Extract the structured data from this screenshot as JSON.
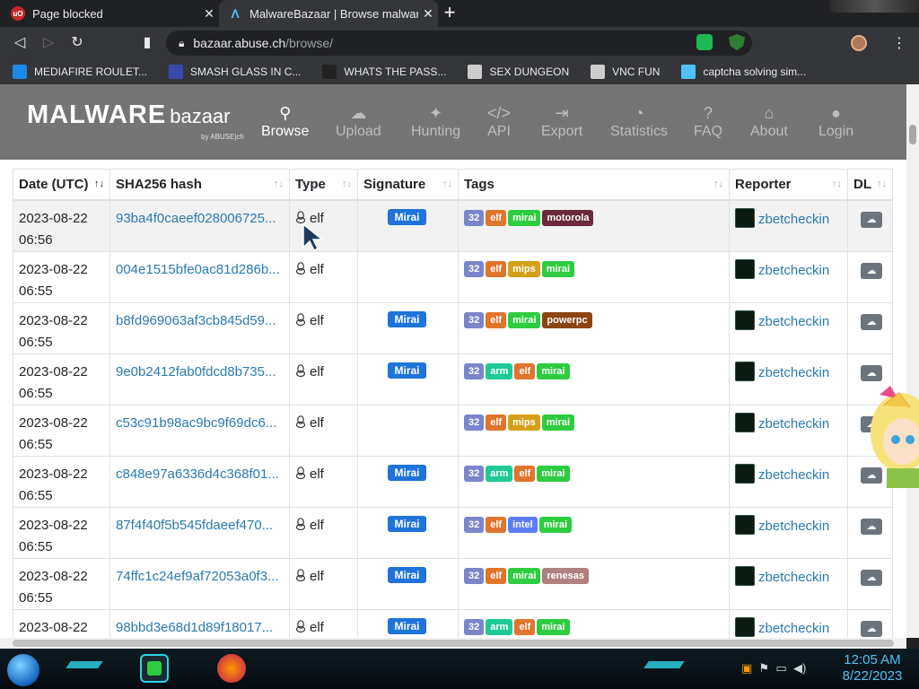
{
  "browser": {
    "tabs": [
      {
        "title": "Page blocked",
        "favicon": "ublock-icon",
        "active": false
      },
      {
        "title": "MalwareBazaar | Browse malware s",
        "favicon": "malwarebazaar-icon",
        "active": true
      }
    ],
    "url_domain": "bazaar.abuse.ch",
    "url_path": "/browse/",
    "bookmarks": [
      {
        "label": "MEDIAFIRE ROULET...",
        "icon": "mediafire-icon",
        "color": "#1e88e5"
      },
      {
        "label": "SMASH GLASS IN C...",
        "icon": "sigma-icon",
        "color": "#3949ab"
      },
      {
        "label": "WHATS THE PASS...",
        "icon": "dark-square-icon",
        "color": "#222222"
      },
      {
        "label": "SEX DUNGEON",
        "icon": "gear-icon",
        "color": "#cccccc"
      },
      {
        "label": "VNC FUN",
        "icon": "gear-icon",
        "color": "#cccccc"
      },
      {
        "label": "captcha solving sim...",
        "icon": "malwarebazaar-icon",
        "color": "#4fc3f7"
      }
    ]
  },
  "site": {
    "brand_main": "MALWARE",
    "brand_sub": "bazaar",
    "brand_by": "by ABUSE|ch",
    "nav": [
      {
        "label": "Browse",
        "icon": "search-icon",
        "active": true
      },
      {
        "label": "Upload",
        "icon": "cloud-upload-icon",
        "active": false
      },
      {
        "label": "Hunting",
        "icon": "hunting-icon",
        "active": false
      },
      {
        "label": "API",
        "icon": "code-icon",
        "active": false
      },
      {
        "label": "Export",
        "icon": "export-icon",
        "active": false
      },
      {
        "label": "Statistics",
        "icon": "pie-chart-icon",
        "active": false
      },
      {
        "label": "FAQ",
        "icon": "question-icon",
        "active": false
      },
      {
        "label": "About",
        "icon": "building-icon",
        "active": false
      },
      {
        "label": "Login",
        "icon": "user-icon",
        "active": false
      }
    ]
  },
  "table": {
    "headers": [
      "Date (UTC)",
      "SHA256 hash",
      "Type",
      "Signature",
      "Tags",
      "Reporter",
      "DL"
    ],
    "rows": [
      {
        "date": "2023-08-22",
        "time": "06:56",
        "hash": "93ba4f0caeef028006725...",
        "type": "elf",
        "signature": "Mirai",
        "tags": [
          "32",
          "elf",
          "mirai",
          "motorola"
        ],
        "reporter": "zbetcheckin"
      },
      {
        "date": "2023-08-22",
        "time": "06:55",
        "hash": "004e1515bfe0ac81d286b...",
        "type": "elf",
        "signature": "",
        "tags": [
          "32",
          "elf",
          "mips",
          "mirai"
        ],
        "reporter": "zbetcheckin"
      },
      {
        "date": "2023-08-22",
        "time": "06:55",
        "hash": "b8fd969063af3cb845d59...",
        "type": "elf",
        "signature": "Mirai",
        "tags": [
          "32",
          "elf",
          "mirai",
          "powerpc"
        ],
        "reporter": "zbetcheckin"
      },
      {
        "date": "2023-08-22",
        "time": "06:55",
        "hash": "9e0b2412fab0fdcd8b735...",
        "type": "elf",
        "signature": "Mirai",
        "tags": [
          "32",
          "arm",
          "elf",
          "mirai"
        ],
        "reporter": "zbetcheckin"
      },
      {
        "date": "2023-08-22",
        "time": "06:55",
        "hash": "c53c91b98ac9bc9f69dc6...",
        "type": "elf",
        "signature": "",
        "tags": [
          "32",
          "elf",
          "mips",
          "mirai"
        ],
        "reporter": "zbetcheckin"
      },
      {
        "date": "2023-08-22",
        "time": "06:55",
        "hash": "c848e97a6336d4c368f01...",
        "type": "elf",
        "signature": "Mirai",
        "tags": [
          "32",
          "arm",
          "elf",
          "mirai"
        ],
        "reporter": "zbetcheckin"
      },
      {
        "date": "2023-08-22",
        "time": "06:55",
        "hash": "87f4f40f5b545fdaeef470...",
        "type": "elf",
        "signature": "Mirai",
        "tags": [
          "32",
          "elf",
          "intel",
          "mirai"
        ],
        "reporter": "zbetcheckin"
      },
      {
        "date": "2023-08-22",
        "time": "06:55",
        "hash": "74ffc1c24ef9af72053a0f3...",
        "type": "elf",
        "signature": "Mirai",
        "tags": [
          "32",
          "elf",
          "mirai",
          "renesas"
        ],
        "reporter": "zbetcheckin"
      },
      {
        "date": "2023-08-22",
        "time": "",
        "hash": "98bbd3e68d1d89f18017...",
        "type": "elf",
        "signature": "Mirai",
        "tags": [
          "32",
          "arm",
          "elf",
          "mirai"
        ],
        "reporter": "zbetcheckin"
      }
    ],
    "tag_colors": {
      "32": "#7986cb",
      "elf": "#e0752d",
      "mirai": "#2ecc40",
      "motorola": "#6b2b3a",
      "mips": "#d4a017",
      "powerpc": "#8b4513",
      "arm": "#20c997",
      "intel": "#5c7cfa",
      "renesas": "#b08080"
    }
  },
  "taskbar": {
    "time": "12:05 AM",
    "date": "8/22/2023"
  }
}
